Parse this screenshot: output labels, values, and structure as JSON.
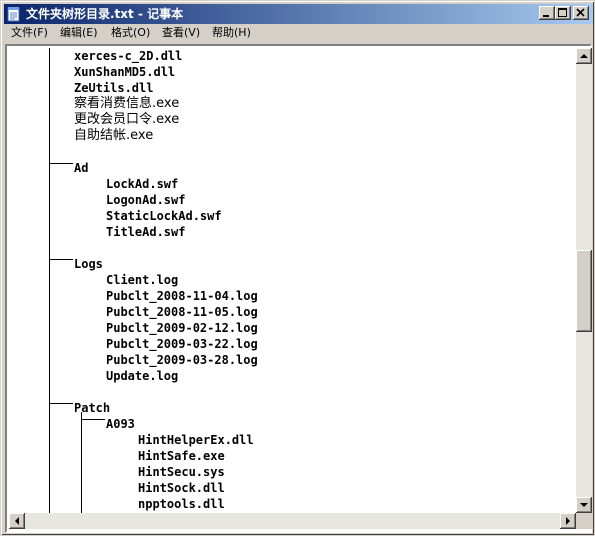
{
  "window": {
    "title": "文件夹树形目录.txt - 记事本",
    "title_color": "#ffffff",
    "titlebar_gradient": [
      "#0a246a",
      "#a6caf0"
    ]
  },
  "menu": {
    "file": "文件(F)",
    "edit": "编辑(E)",
    "format": "格式(O)",
    "view": "查看(V)",
    "help": "帮助(H)"
  },
  "icons": {
    "app": "notepad-icon",
    "minimize": "minimize-icon",
    "maximize": "maximize-icon",
    "close": "close-icon"
  },
  "content": {
    "top_files": [
      "xerces-c_2D.dll",
      "XunShanMD5.dll",
      "ZeUtils.dll"
    ],
    "cjk_files": [
      "察看消费信息.exe",
      "更改会员口令.exe",
      "自助结帐.exe"
    ],
    "ad_folder": "Ad",
    "ad_files": [
      "LockAd.swf",
      "LogonAd.swf",
      "StaticLockAd.swf",
      "TitleAd.swf"
    ],
    "logs_folder": "Logs",
    "logs_files": [
      "Client.log",
      "Pubclt_2008-11-04.log",
      "Pubclt_2008-11-05.log",
      "Pubclt_2009-02-12.log",
      "Pubclt_2009-03-22.log",
      "Pubclt_2009-03-28.log",
      "Update.log"
    ],
    "patch_folder": "Patch",
    "subfolder": "A093",
    "subfolder_files": [
      "HintHelperEx.dll",
      "HintSafe.exe",
      "HintSecu.sys",
      "HintSock.dll",
      "npptools.dll"
    ]
  },
  "scroll": {
    "vertical_position": 0.5
  }
}
